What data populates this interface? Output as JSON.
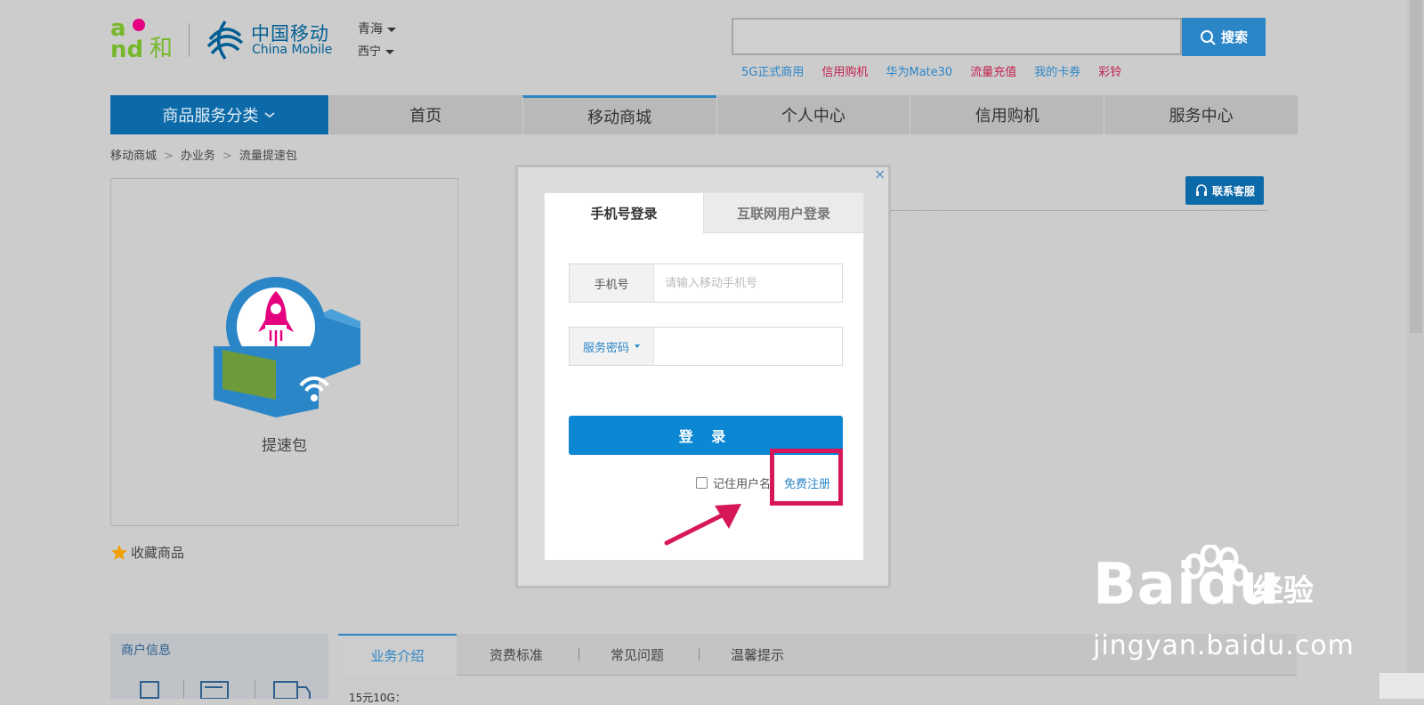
{
  "header": {
    "brand_en": "China Mobile",
    "brand_cn": "中国移动",
    "logo_and": "and和",
    "region": "青海",
    "city": "西宁",
    "search": {
      "placeholder": "",
      "button_label": "搜索"
    },
    "hot_links": [
      {
        "label": "5G正式商用",
        "color": "#2b86c8"
      },
      {
        "label": "信用购机",
        "color": "#c4214f"
      },
      {
        "label": "华为Mate30",
        "color": "#2b86c8"
      },
      {
        "label": "流量充值",
        "color": "#c4214f"
      },
      {
        "label": "我的卡券",
        "color": "#2b86c8"
      },
      {
        "label": "彩铃",
        "color": "#c4214f"
      }
    ]
  },
  "nav": {
    "category": "商品服务分类",
    "items": [
      "首页",
      "移动商城",
      "个人中心",
      "信用购机",
      "服务中心"
    ],
    "active_index": 1
  },
  "breadcrumb": [
    "移动商城",
    "办业务",
    "流量提速包"
  ],
  "product": {
    "caption": "提速包",
    "favorite_label": "收藏商品"
  },
  "contact_label": "联系客服",
  "modal": {
    "close": "×",
    "tabs": [
      "手机号登录",
      "互联网用户登录"
    ],
    "phone_label": "手机号",
    "phone_placeholder": "请输入移动手机号",
    "password_label": "服务密码",
    "login_label": "登 录",
    "remember_label": "记住用户名",
    "register_label": "免费注册"
  },
  "bottom": {
    "merchant_title": "商户信息",
    "tabs": [
      "业务介绍",
      "资费标准",
      "常见问题",
      "温馨提示"
    ],
    "content": "15元10G："
  },
  "watermark": {
    "brand": "Baidu",
    "brand_cn": "经验",
    "url": "jingyan.baidu.com"
  },
  "colors": {
    "brand_blue": "#0d6aa8",
    "accent_pink": "#d6185b",
    "button_blue": "#0b87d3"
  }
}
